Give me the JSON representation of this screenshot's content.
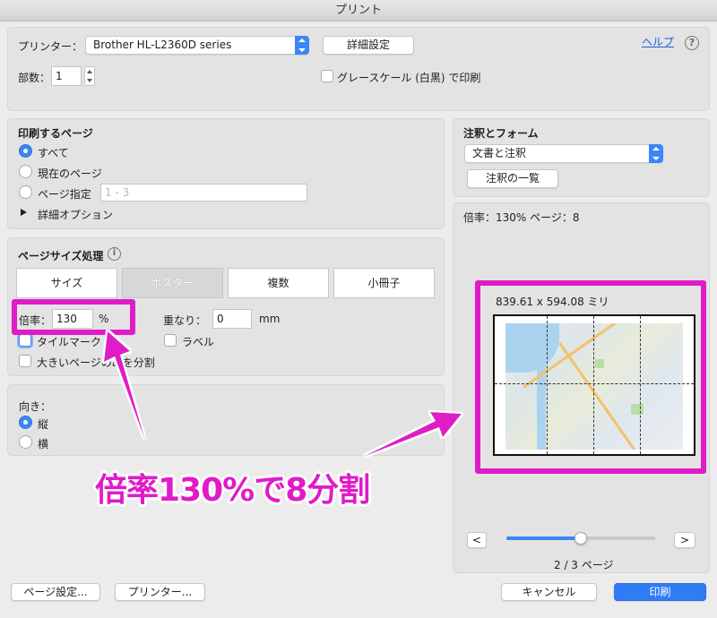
{
  "window": {
    "title": "プリント"
  },
  "printer": {
    "label": "プリンター：",
    "value": "Brother HL-L2360D series",
    "settings_button": "詳細設定",
    "help_link": "ヘルプ",
    "help_icon": "question-circle-icon"
  },
  "copies": {
    "label": "部数：",
    "value": "1"
  },
  "grayscale": {
    "label": "グレースケール (白黒) で印刷",
    "checked": false
  },
  "pages": {
    "title": "印刷するページ",
    "all": "すべて",
    "current": "現在のページ",
    "range": "ページ指定",
    "range_placeholder": "1 - 3",
    "details": "詳細オプション"
  },
  "page_size": {
    "title": "ページサイズ処理",
    "info_icon": "info-icon",
    "tabs": [
      "サイズ",
      "ポスター",
      "複数",
      "小冊子"
    ],
    "active_tab": "ポスター",
    "scale_label": "倍率：",
    "scale_value": "130",
    "scale_unit": "%",
    "overlap_label": "重なり：",
    "overlap_value": "0",
    "overlap_unit": "mm",
    "tile_marks": "タイルマーク",
    "labels": "ラベル",
    "split_large": "大きいページのみを分割"
  },
  "orientation": {
    "title": "向き：",
    "portrait": "縦",
    "landscape": "横"
  },
  "annotations": {
    "title": "注釈とフォーム",
    "value": "文書と注釈",
    "list_button": "注釈の一覧"
  },
  "preview": {
    "info": "倍率：130% ページ：8",
    "dimensions": "839.61 x 594.08 ミリ",
    "page_indicator": "2 / 3 ページ",
    "prev": "<",
    "next": ">",
    "slider_fraction": 0.5
  },
  "footer": {
    "page_setup": "ページ設定...",
    "printer": "プリンター...",
    "cancel": "キャンセル",
    "print": "印刷"
  },
  "overlay": {
    "caption": "倍率130%で8分割",
    "color": "#e01bc8"
  }
}
